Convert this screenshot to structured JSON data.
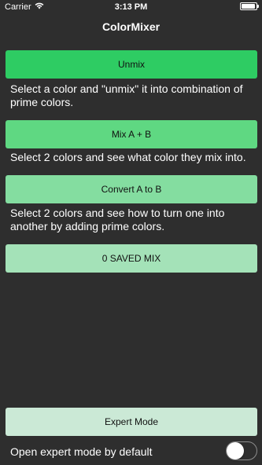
{
  "status_bar": {
    "carrier": "Carrier",
    "time": "3:13 PM"
  },
  "nav": {
    "title": "ColorMixer"
  },
  "buttons": {
    "unmix": "Unmix",
    "mix": "Mix A + B",
    "convert": "Convert A to B",
    "saved": "0 SAVED MIX",
    "expert": "Expert Mode"
  },
  "descriptions": {
    "unmix": "Select a color and \"unmix\" it into combination of prime colors.",
    "mix": "Select 2 colors and see what color they mix into.",
    "convert": "Select 2 colors and see how to turn one into another by adding prime colors."
  },
  "settings": {
    "expert_default_label": "Open expert mode by default",
    "expert_default_on": false
  },
  "colors": {
    "background": "#2e2e2e",
    "unmix_button": "#2ecc63",
    "mix_button": "#5fd882",
    "convert_button": "#84dda0",
    "saved_button": "#a4e2b8",
    "expert_button": "#cbe9d6"
  }
}
